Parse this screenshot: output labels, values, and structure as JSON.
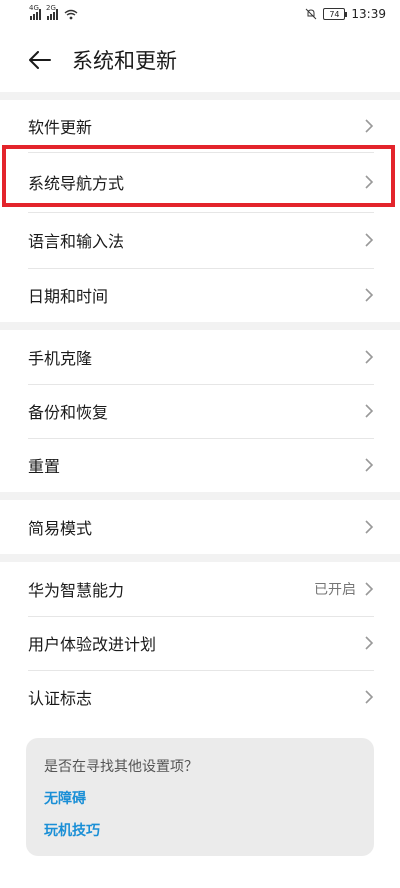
{
  "status_bar": {
    "signal1_label": "4G",
    "signal2_label": "2G",
    "battery": "74",
    "time": "13:39"
  },
  "header": {
    "title": "系统和更新"
  },
  "groups": [
    {
      "items": [
        {
          "label": "软件更新"
        },
        {
          "label": "系统导航方式"
        },
        {
          "label": "语言和输入法"
        },
        {
          "label": "日期和时间"
        }
      ]
    },
    {
      "items": [
        {
          "label": "手机克隆"
        },
        {
          "label": "备份和恢复"
        },
        {
          "label": "重置"
        }
      ]
    },
    {
      "items": [
        {
          "label": "简易模式"
        }
      ]
    },
    {
      "items": [
        {
          "label": "华为智慧能力",
          "value": "已开启"
        },
        {
          "label": "用户体验改进计划"
        },
        {
          "label": "认证标志"
        }
      ]
    }
  ],
  "suggestion_card": {
    "question": "是否在寻找其他设置项？",
    "links": [
      "无障碍",
      "玩机技巧"
    ]
  },
  "colors": {
    "highlight": "#e3242b",
    "link": "#1a8fd6"
  }
}
